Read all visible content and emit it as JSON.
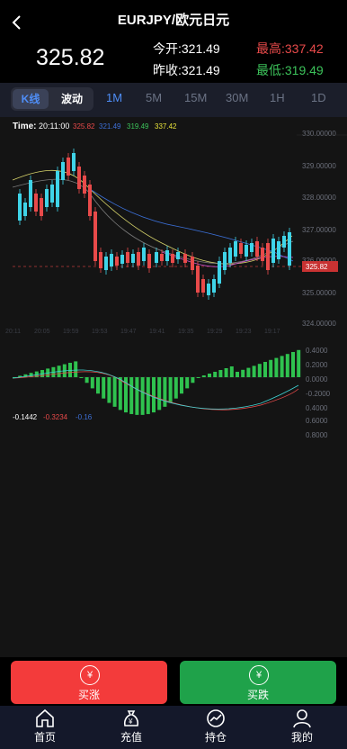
{
  "header": {
    "title": "EURJPY/欧元日元",
    "price": "325.82",
    "open_label": "今开:",
    "open_value": "321.49",
    "prev_close_label": "昨收:",
    "prev_close_value": "321.49",
    "high_label": "最高:",
    "high_value": "337.42",
    "low_label": "最低:",
    "low_value": "319.49"
  },
  "chart_mode": {
    "kline": "K线",
    "wave": "波动"
  },
  "timeframes": [
    "1M",
    "5M",
    "15M",
    "30M",
    "1H",
    "1D"
  ],
  "chart_data": {
    "type": "candlestick",
    "info": {
      "time_label": "Time:",
      "time": "20:11:00",
      "v1": "325.82",
      "v2": "321.49",
      "v3": "319.49",
      "v4": "337.42"
    },
    "y_ticks": [
      "330.00000",
      "329.00000",
      "328.00000",
      "327.00000",
      "326.00000",
      "325.00000",
      "324.00000"
    ],
    "last_price_tag": "325.82",
    "x_ticks": [
      "20:11",
      "20:05",
      "19:59",
      "19:53",
      "19:47",
      "19:41",
      "19:35",
      "19:29",
      "19:23",
      "19:17"
    ],
    "macd_ticks": [
      "0.4000",
      "0.2000",
      "0.0000",
      "-0.2000",
      "0.4000",
      "0.6000",
      "0.8000"
    ],
    "macd_values": [
      "-0.1442",
      "-0.3234",
      "-0.16"
    ]
  },
  "actions": {
    "buy_label": "买涨",
    "sell_label": "买跌",
    "currency_symbol": "¥"
  },
  "nav": {
    "home": "首页",
    "recharge": "充值",
    "positions": "持仓",
    "mine": "我的"
  }
}
